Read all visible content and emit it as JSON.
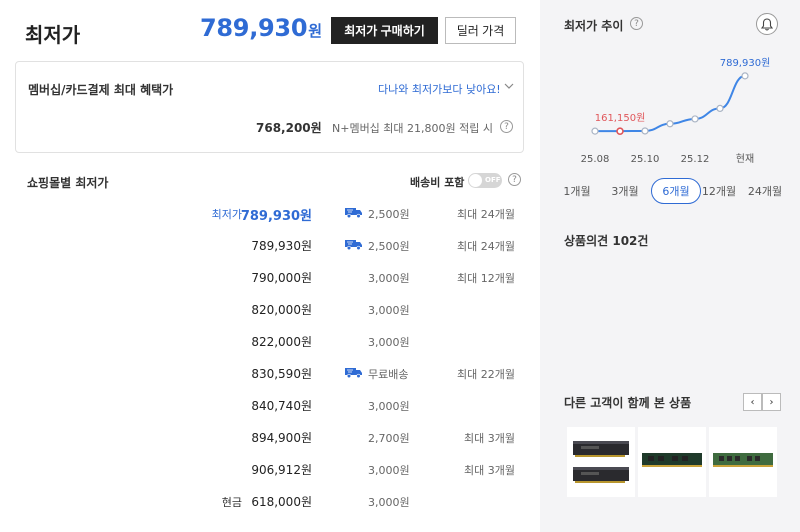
{
  "header": {
    "title": "최저가",
    "price_value": "789,930",
    "price_unit": "원",
    "buy_button": "최저가 구매하기",
    "dealer_button": "딜러 가격"
  },
  "benefit": {
    "title": "멤버십/카드결제 최대 혜택가",
    "link": "다나와 최저가보다 낮아요!",
    "price": "768,200원",
    "note": "N+멤버십 최대 21,800원 적립 시"
  },
  "mall": {
    "title": "쇼핑몰별 최저가",
    "shipping_toggle_label": "배송비 포함",
    "toggle_state": "OFF",
    "rows": [
      {
        "label": "최저가",
        "price": "789,930원",
        "truck": true,
        "shipping": "2,500원",
        "installment": "최대 24개월"
      },
      {
        "label": "",
        "price": "789,930원",
        "truck": true,
        "shipping": "2,500원",
        "installment": "최대 24개월"
      },
      {
        "label": "",
        "price": "790,000원",
        "truck": false,
        "shipping": "3,000원",
        "installment": "최대 12개월"
      },
      {
        "label": "",
        "price": "820,000원",
        "truck": false,
        "shipping": "3,000원",
        "installment": ""
      },
      {
        "label": "",
        "price": "822,000원",
        "truck": false,
        "shipping": "3,000원",
        "installment": ""
      },
      {
        "label": "",
        "price": "830,590원",
        "truck": true,
        "shipping": "무료배송",
        "installment": "최대 22개월"
      },
      {
        "label": "",
        "price": "840,740원",
        "truck": false,
        "shipping": "3,000원",
        "installment": ""
      },
      {
        "label": "",
        "price": "894,900원",
        "truck": false,
        "shipping": "2,700원",
        "installment": "최대 3개월"
      },
      {
        "label": "",
        "price": "906,912원",
        "truck": false,
        "shipping": "3,000원",
        "installment": "최대 3개월"
      },
      {
        "label": "현금",
        "price": "618,000원",
        "truck": false,
        "shipping": "3,000원",
        "installment": ""
      }
    ]
  },
  "trend": {
    "title": "최저가 추이",
    "tabs": [
      "1개월",
      "3개월",
      "6개월",
      "12개월",
      "24개월"
    ],
    "active_tab": "6개월"
  },
  "chart_data": {
    "type": "line",
    "x": [
      "25.08",
      "",
      "25.10",
      "",
      "25.12",
      "",
      "현재"
    ],
    "tick_labels": [
      "25.08",
      "25.10",
      "25.12",
      "현재"
    ],
    "series": [
      {
        "values": [
          161150,
          161150,
          163000,
          245000,
          300000,
          420000,
          789930
        ]
      }
    ],
    "annotations": [
      {
        "text": "161,150원",
        "index": 1,
        "color": "#e0565a"
      },
      {
        "text": "789,930원",
        "index": 6,
        "color": "#2f6bd4"
      }
    ],
    "line_color": "#3f86e6"
  },
  "reviews": {
    "label": "상품의견 102건"
  },
  "others": {
    "title": "다른 고객이 함께 본 상품",
    "prev": "‹",
    "next": "›"
  },
  "colors": {
    "accent": "#2f6bd4",
    "low_marker": "#e0565a"
  }
}
